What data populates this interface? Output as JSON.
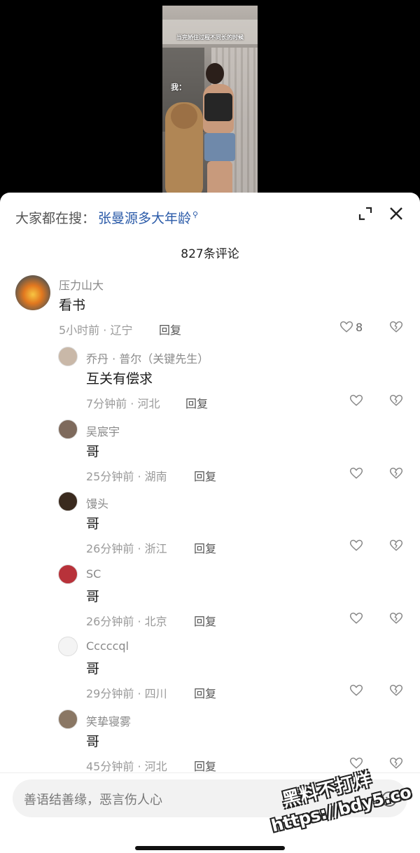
{
  "video": {
    "caption": "当完娇住过程不同长的时候",
    "label": "我："
  },
  "search": {
    "prefix": "大家都在搜：",
    "term": "张曼源多大年龄",
    "term_icon": "search-icon"
  },
  "header": {
    "comment_count": "827条评论",
    "expand_icon": "expand-icon",
    "close_icon": "close-icon"
  },
  "top_comment": {
    "username": "压力山大",
    "content": "看书",
    "meta": "5小时前 · 辽宁",
    "reply_label": "回复",
    "like_count": "8"
  },
  "replies": [
    {
      "username": "乔丹 · 普尔（关键先生）",
      "content": "互关有偿求",
      "meta": "7分钟前 · 河北",
      "reply_label": "回复",
      "avatar_color": "#c9b8a8"
    },
    {
      "username": "吴宸宇",
      "content": "哥",
      "meta": "25分钟前 · 湖南",
      "reply_label": "回复",
      "avatar_color": "#7e6a5c"
    },
    {
      "username": "馒头",
      "content": "哥",
      "meta": "26分钟前 · 浙江",
      "reply_label": "回复",
      "avatar_color": "#3a2a1e"
    },
    {
      "username": "SC",
      "content": "哥",
      "meta": "26分钟前 · 北京",
      "reply_label": "回复",
      "avatar_color": "#b8323a"
    },
    {
      "username": "Cccccql",
      "content": "哥",
      "meta": "29分钟前 · 四川",
      "reply_label": "回复",
      "avatar_color": "#f4f4f4"
    },
    {
      "username": "笑挚寝雾",
      "content": "哥",
      "meta": "45分钟前 · 河北",
      "reply_label": "回复",
      "avatar_color": "#8a7764"
    }
  ],
  "input": {
    "placeholder": "善语结善缘，恶言伤人心",
    "emoji_icon": "emoji-icon"
  },
  "watermark": {
    "line1": "黑料不打烊",
    "line2": "https://bdy5.co"
  },
  "colors": {
    "link": "#2a5aa8",
    "muted": "#9a9a9a",
    "text": "#1a1a1a"
  }
}
